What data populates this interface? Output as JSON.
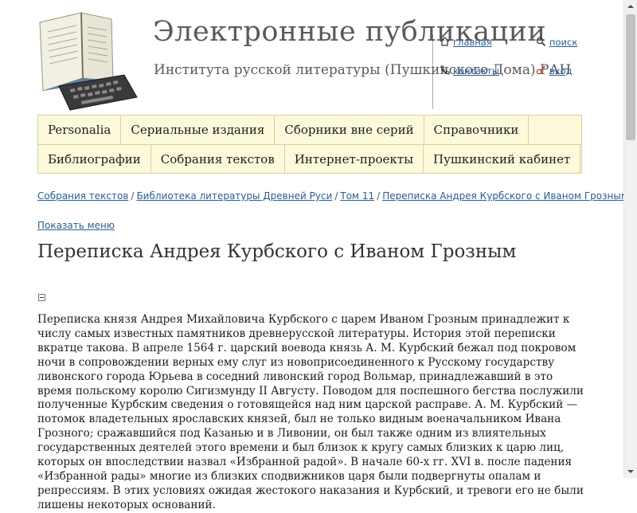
{
  "header": {
    "title": "Электронные публикации",
    "subtitle": "Института русской литературы (Пушкинского Дома) РАН",
    "links": {
      "home": "главная",
      "search": "поиск",
      "contacts": "контакты",
      "login": "вход"
    }
  },
  "nav": {
    "row1": [
      "Personalia",
      "Сериальные издания",
      "Сборники вне серий",
      "Справочники"
    ],
    "row2": [
      "Библиографии",
      "Собрания текстов",
      "Интернет-проекты",
      "Пушкинский кабинет"
    ]
  },
  "breadcrumb": [
    "Собрания текстов",
    "Библиотека литературы Древней Руси",
    "Том 11",
    "Переписка Андрея Курбского с Иваном Грозным"
  ],
  "breadcrumb_separator": "/",
  "show_menu": "Показать меню",
  "page_title": "Переписка Андрея Курбского с Иваном Грозным",
  "body": "Переписка князя Андрея Михайловича Курбского с царем Иваном Грозным принадлежит к числу самых известных памятников древнерусской литературы. История этой переписки вкратце такова. В апреле 1564 г. царский воевода князь А. М. Курбский бежал под покровом ночи в сопровождении верных ему слуг из новоприсоединенного к Русскому государству ливонского города Юрьева в соседний ливонский город Вольмар, принадлежавший в это время польскому королю Сигизмунду II Августу. Поводом для поспешного бегства послужили полученные Курбским сведения о готовящейся над ним царской расправе. А. М. Курбский — потомок владетельных ярославских князей, был не только видным военачальником Ивана Грозного; сражавшийся под Казанью и в Ливонии, он был также одним из влиятельных государственных деятелей этого времени и был близок к кругу самых близких к царю лиц, которых он впоследствии назвал «Избранной радой». В начале 60-х гг. XVI в. после падения «Избранной рады» многие из близких сподвижников царя были подвергнуты опалам и репрессиям. В этих условиях ожидая жестокого наказания и Курбский, и тревоги его не были лишены некоторых оснований.",
  "colors": {
    "link": "#2a5d92",
    "nav_bg": "#fdfadb",
    "nav_border": "#d6d0a0",
    "title_gray": "#5a5a5a"
  }
}
